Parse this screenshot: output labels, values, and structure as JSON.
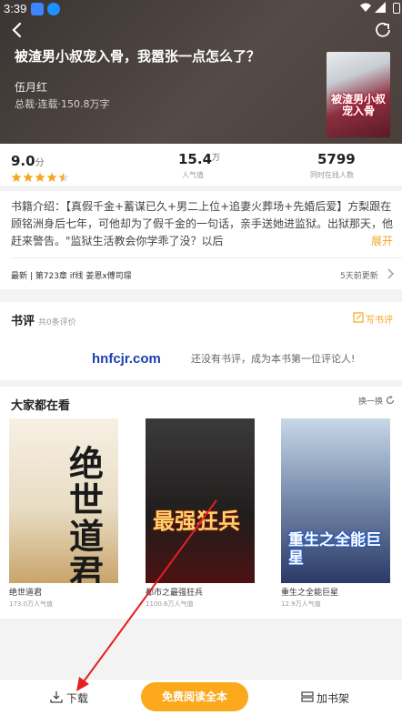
{
  "status_bar": {
    "time": "3:39"
  },
  "book": {
    "title": "被渣男小叔宠入骨，我嚣张一点怎么了？",
    "author": "伍月红",
    "meta": "总裁·连载·150.8万字",
    "cover_text": "被渣男小叔宠入骨"
  },
  "stats": {
    "score": "9.0",
    "score_unit": "分",
    "rating_stars": 4.5,
    "popularity": "15.4",
    "popularity_unit": "万",
    "popularity_label": "人气值",
    "online": "5799",
    "online_label": "同时在线人数"
  },
  "synopsis": {
    "text": "书籍介绍：【真假千金+蓄谋已久+男二上位+追妻火葬场+先婚后爱】方梨跟在顾铭洲身后七年，可他却为了假千金的一句话，亲手送她进监狱。出狱那天，他赶来警告。\"监狱生活教会你学乖了没？以后",
    "more": "展开",
    "latest_chapter": "最新 | 第723章 if线 姜恩x傅司璟",
    "latest_time": "5天前更新"
  },
  "reviews": {
    "title": "书评",
    "count": "共0条评价",
    "write": "写书评",
    "empty": "还没有书评，成为本书第一位评论人!"
  },
  "watermark": "hnfcjr.com",
  "recommendations": {
    "title": "大家都在看",
    "refresh": "换一换",
    "books": [
      {
        "name": "绝世道君",
        "popularity": "173.0万人气值",
        "cover_text": "绝世道君"
      },
      {
        "name": "都市之最强狂兵",
        "popularity": "1100.6万人气值",
        "cover_text": "最强狂兵"
      },
      {
        "name": "重生之全能巨星",
        "popularity": "12.9万人气值",
        "cover_text": "重生之全能巨星"
      }
    ]
  },
  "bottom_bar": {
    "download": "下载",
    "read": "免费阅读全本",
    "shelf": "加书架"
  },
  "colors": {
    "accent": "#fba81c",
    "star": "#f5a623"
  }
}
